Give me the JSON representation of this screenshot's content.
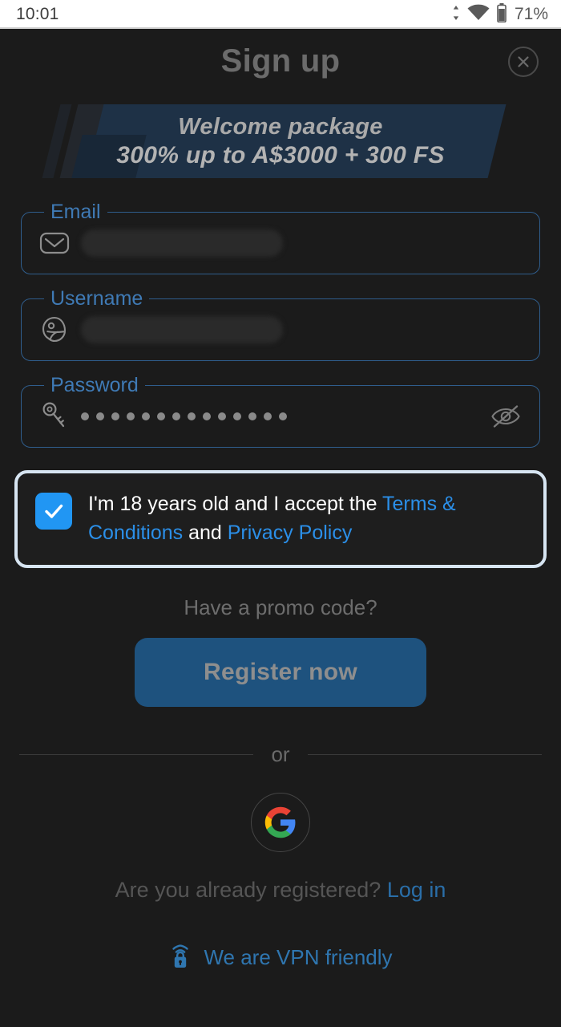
{
  "statusbar": {
    "time": "10:01",
    "battery_text": "71%",
    "icons": [
      "data-transfer-icon",
      "wifi-icon",
      "battery-icon"
    ]
  },
  "header": {
    "title": "Sign up",
    "close_label": "×"
  },
  "banner": {
    "line1": "Welcome package",
    "line2": "300% up to A$3000 + 300 FS",
    "bg_color": "#1e3146"
  },
  "form": {
    "email": {
      "label": "Email",
      "value": "",
      "placeholder": "",
      "icon": "envelope-icon",
      "redacted": true
    },
    "username": {
      "label": "Username",
      "value": "",
      "placeholder": "",
      "icon": "helmet-icon",
      "redacted": true
    },
    "password": {
      "label": "Password",
      "value": "••••••••••••••",
      "dot_count": 14,
      "icon": "key-icon",
      "toggle_icon": "eye-off-icon",
      "masked": true
    }
  },
  "terms": {
    "text_before": "I'm 18 years old and I accept the ",
    "link_terms": "Terms & Conditions",
    "text_middle": " and ",
    "link_privacy": "Privacy Policy",
    "checked": true,
    "focus_color": "#d7e5f2",
    "checkbox_color": "#2196f3",
    "link_color": "#2b8fe8"
  },
  "promo": {
    "label": "Have a promo code?"
  },
  "register": {
    "label": "Register now",
    "bg_color": "#1e527e"
  },
  "divider": {
    "label": "or"
  },
  "social": {
    "google_label": "G",
    "icon": "google-icon"
  },
  "footer": {
    "login_prompt": "Are you already registered?",
    "login_link": "Log in",
    "vpn_text": "We are VPN friendly",
    "vpn_icon": "vpn-lock-icon",
    "link_color": "#2a6ea8"
  }
}
